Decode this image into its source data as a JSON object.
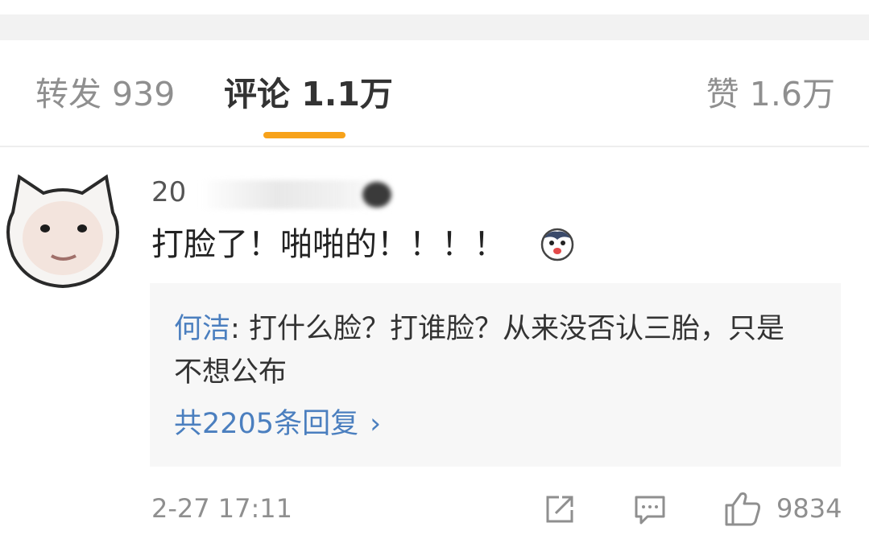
{
  "tabs": {
    "repost_label": "转发 939",
    "comments_label": "评论 1.1万",
    "likes_label": "赞 1.6万"
  },
  "comment": {
    "username_partial": "20",
    "text": "打脸了！啪啪的！！！！",
    "emoji_icon": "husky-face-icon",
    "reply": {
      "author": "何洁",
      "separator": ": ",
      "text": "打什么脸？打谁脸？从来没否认三胎，只是不想公布",
      "more_label": "共2205条回复",
      "more_chevron": "›"
    },
    "timestamp": "2-27 17:11",
    "like_count": "9834"
  },
  "colors": {
    "tab_active_underline": "#f7a21a",
    "link_blue": "#4b7fbf",
    "reply_background": "#f7f7f7"
  }
}
